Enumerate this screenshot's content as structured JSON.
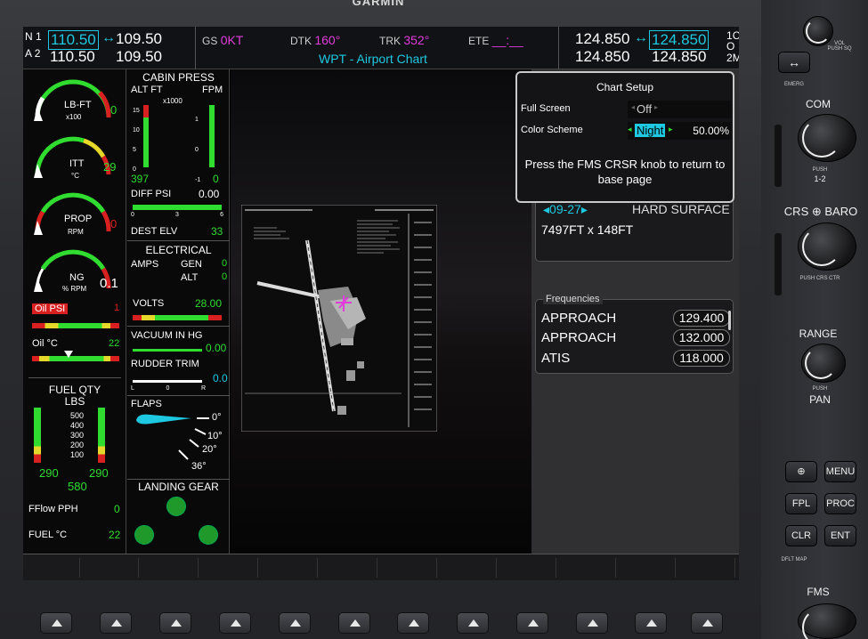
{
  "brand": "GARMIN",
  "nav": {
    "nav1_label": "N",
    "nav1_num": "1",
    "nav2_label": "A",
    "nav2_num": "2",
    "nav1_active": "110.50",
    "nav1_standby": "109.50",
    "nav2_active": "110.50",
    "nav2_standby": "109.50",
    "swap_glyph": "↔"
  },
  "data_fields": {
    "gs_label": "GS",
    "gs_value": "0KT",
    "dtk_label": "DTK",
    "dtk_value": "160°",
    "trk_label": "TRK",
    "trk_value": "352°",
    "ete_label": "ETE",
    "ete_value": "__:__"
  },
  "page_title": "WPT - Airport Chart",
  "com": {
    "com1_active": "124.850",
    "com1_standby": "124.850",
    "com2_active": "124.850",
    "com2_standby": "124.850",
    "label_c": "C",
    "label_o": "O",
    "label_m": "M",
    "num1": "1",
    "num2": "2"
  },
  "eis": {
    "torque_label": "LB-FT",
    "torque_unit": "x100",
    "torque_value": "0",
    "itt_label": "ITT",
    "itt_unit": "°C",
    "itt_value": "29",
    "prop_label": "PROP",
    "prop_unit": "RPM",
    "prop_value": "0",
    "ng_label": "NG",
    "ng_unit": "% RPM",
    "ng_value": "0.1",
    "oil_psi_label": "Oil PSI",
    "oil_psi_value": "1",
    "oil_c_label": "Oil °C",
    "oil_c_value": "22",
    "fuel_qty_title": "FUEL QTY",
    "fuel_qty_unit": "LBS",
    "fuel_ticks": [
      "500",
      "400",
      "300",
      "200",
      "100"
    ],
    "fuel_left": "290",
    "fuel_right": "290",
    "fuel_total": "580",
    "fflow_label": "FFlow PPH",
    "fflow_value": "0",
    "fuel_temp_label": "FUEL °C",
    "fuel_temp_value": "22",
    "cabin_title": "CABIN PRESS",
    "alt_ft_label": "ALT FT",
    "fpm_label": "FPM",
    "x1000_label": "x1000",
    "alt_ticks": [
      "15",
      "10",
      "5",
      "0"
    ],
    "fpm_ticks": [
      "1",
      "0",
      "-1"
    ],
    "cabin_alt_value": "397",
    "cabin_fpm_value": "0",
    "diff_psi_label": "DIFF PSI",
    "diff_psi_value": "0.00",
    "diff_ticks": [
      "0",
      "3",
      "6"
    ],
    "dest_elv_label": "DEST ELV",
    "dest_elv_value": "33",
    "electrical_title": "ELECTRICAL",
    "amps_label": "AMPS",
    "gen_label": "GEN",
    "gen_value": "0",
    "alt_label": "ALT",
    "alt_value": "0",
    "volts_label": "VOLTS",
    "volts_value": "28.00",
    "vacuum_label": "VACUUM IN HG",
    "vacuum_value": "0.00",
    "rudder_label": "RUDDER TRIM",
    "rudder_value": "0.0",
    "rudder_ticks": [
      "L",
      "0",
      "R"
    ],
    "flaps_label": "FLAPS",
    "flap_marks": [
      "0°",
      "10°",
      "20°",
      "36°"
    ],
    "gear_title": "LANDING GEAR"
  },
  "chart_setup": {
    "title": "Chart Setup",
    "full_screen_label": "Full Screen",
    "full_screen_value": "Off",
    "color_scheme_label": "Color Scheme",
    "color_scheme_value": "Night",
    "brightness_value": "50.00%",
    "message": "Press the FMS CRSR knob to return to base page"
  },
  "runway_card": {
    "runway": "09-27",
    "surface": "HARD SURFACE",
    "dimensions": "7497FT x 148FT"
  },
  "frequencies": {
    "title": "Frequencies",
    "rows": [
      {
        "name": "APPROACH",
        "mhz": "129.400"
      },
      {
        "name": "APPROACH",
        "mhz": "132.000"
      },
      {
        "name": "ATIS",
        "mhz": "118.000"
      }
    ]
  },
  "right_panel": {
    "vol_label": "VOL",
    "sq_label": "PUSH SQ",
    "emerg_label": "EMERG",
    "com_label": "COM",
    "com_push": "PUSH",
    "com_sub": "1-2",
    "crs_baro_label": "CRS ⊕ BARO",
    "crs_push": "PUSH CRS CTR",
    "range_label": "RANGE",
    "pan_push": "PUSH",
    "pan_label": "PAN",
    "dflt_map": "DFLT MAP",
    "buttons": {
      "direct": "⊕",
      "menu": "MENU",
      "fpl": "FPL",
      "proc": "PROC",
      "clr": "CLR",
      "ent": "ENT"
    },
    "fms_label": "FMS"
  },
  "colors": {
    "cyan": "#1ec8e0",
    "magenta": "#e03cdc",
    "green": "#2fdc2f",
    "red": "#d82020",
    "yellow": "#e6d82a"
  }
}
